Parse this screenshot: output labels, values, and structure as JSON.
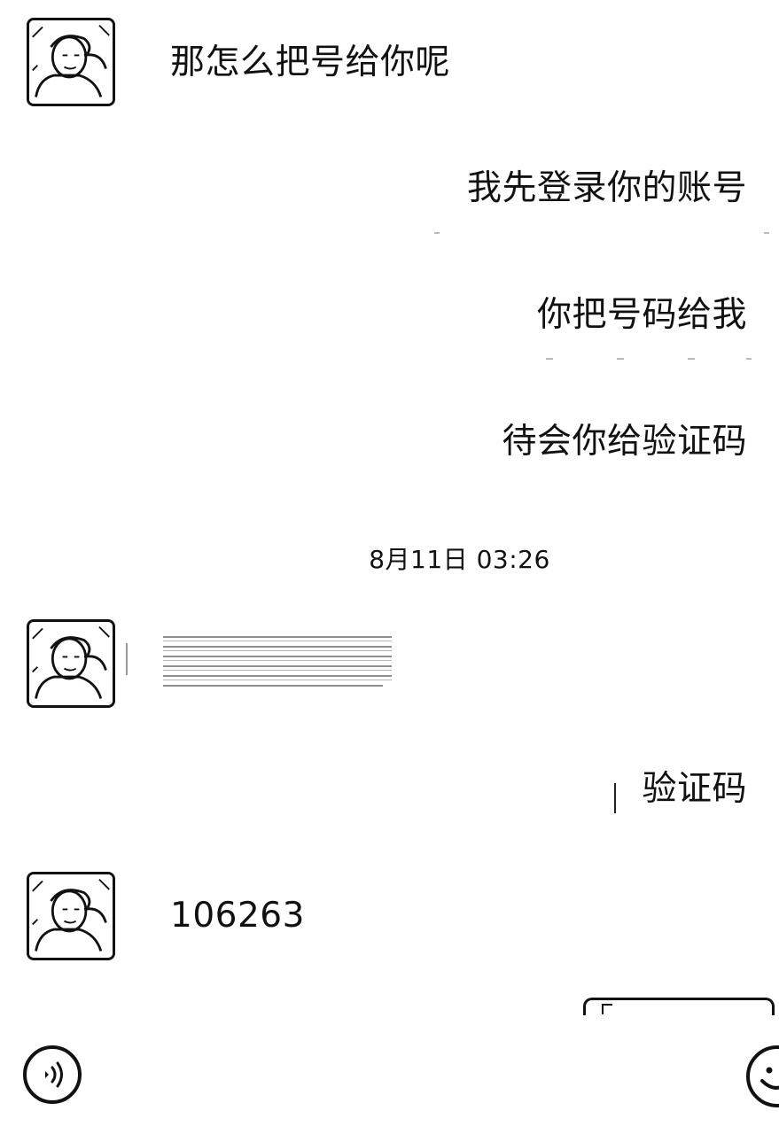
{
  "chat": {
    "messages": [
      {
        "side": "left",
        "text": "那怎么把号给你呢"
      },
      {
        "side": "right",
        "text": "我先登录你的账号"
      },
      {
        "side": "right",
        "text": "你把号码给我"
      },
      {
        "side": "right",
        "text": "待会你给验证码"
      },
      {
        "side": "left",
        "text": ""
      },
      {
        "side": "right",
        "text": "验证码"
      },
      {
        "side": "left",
        "text": "106263"
      }
    ],
    "timestamp": "8月11日 03:26"
  },
  "icons": {
    "avatar": "avatar-portrait-icon",
    "voice": "voice-icon",
    "emoji": "emoji-smiley-icon"
  },
  "colors": {
    "background": "#ffffff",
    "text": "#111111"
  }
}
